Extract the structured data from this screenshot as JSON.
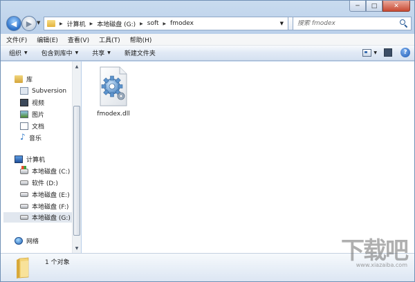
{
  "window": {
    "controls": {
      "minimize": "─",
      "maximize": "□",
      "close": "✕"
    }
  },
  "nav": {
    "back_glyph": "◀",
    "forward_glyph": "▶",
    "breadcrumbs": [
      "计算机",
      "本地磁盘 (G:)",
      "soft",
      "fmodex"
    ],
    "search_placeholder": "搜索 fmodex"
  },
  "menubar": {
    "items": [
      "文件(F)",
      "编辑(E)",
      "查看(V)",
      "工具(T)",
      "帮助(H)"
    ]
  },
  "commandbar": {
    "items": [
      "组织",
      "包含到库中",
      "共享",
      "新建文件夹"
    ],
    "help": "?"
  },
  "sidebar": {
    "libraries_header": "库",
    "libraries": [
      "Subversion",
      "视频",
      "图片",
      "文档",
      "音乐"
    ],
    "computer_header": "计算机",
    "drives": [
      "本地磁盘 (C:)",
      "软件 (D:)",
      "本地磁盘 (E:)",
      "本地磁盘 (F:)",
      "本地磁盘 (G:)"
    ],
    "network": "网络"
  },
  "content": {
    "files": [
      {
        "name": "fmodex.dll",
        "icon": "gear-dll-icon"
      }
    ]
  },
  "details": {
    "status": "1 个对象"
  },
  "watermark": {
    "main": "下载吧",
    "url": "www.xiazaiba.com"
  }
}
